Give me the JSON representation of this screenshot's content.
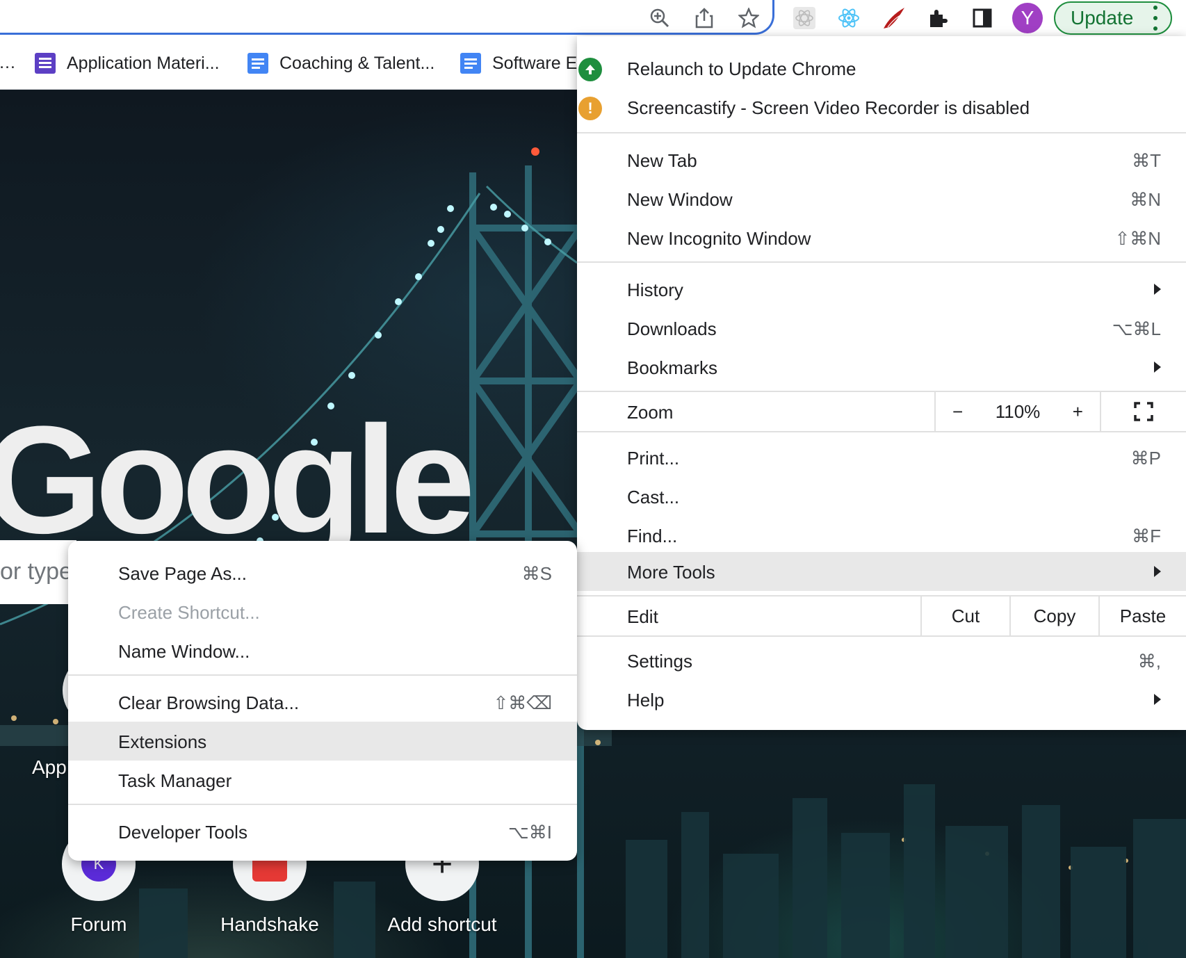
{
  "toolbar": {
    "avatar_letter": "Y",
    "update_label": "Update",
    "extension_icons": [
      "zoom-icon",
      "share-icon",
      "star-icon",
      "react-devtools-grey-icon",
      "react-devtools-icon",
      "red-wing-extension-icon",
      "puzzle-extensions-icon",
      "side-panel-icon"
    ]
  },
  "bookmarks": [
    {
      "label": "Application Materi...",
      "color": "#5c3fc4",
      "icon": "forms-icon"
    },
    {
      "label": "Coaching & Talent...",
      "color": "#4285f4",
      "icon": "docs-icon"
    },
    {
      "label": "Software E",
      "color": "#4285f4",
      "icon": "docs-icon"
    }
  ],
  "page": {
    "logo_text": "Google",
    "search_placeholder": "or type",
    "shortcuts": [
      {
        "label": "App"
      },
      {
        "label": "Forum",
        "icon_letter": "K"
      },
      {
        "label": "Handshake"
      },
      {
        "label": "Add shortcut",
        "icon": "+"
      }
    ]
  },
  "main_menu": {
    "notices": [
      {
        "text": "Relaunch to Update Chrome",
        "icon": "update-arrow-icon",
        "color": "#1e8e3e"
      },
      {
        "text": "Screencastify - Screen Video Recorder is disabled",
        "icon": "warning-icon",
        "color": "#e8a030",
        "glyph": "!"
      }
    ],
    "new_tab": {
      "label": "New Tab",
      "shortcut": "⌘T"
    },
    "new_window": {
      "label": "New Window",
      "shortcut": "⌘N"
    },
    "new_incognito": {
      "label": "New Incognito Window",
      "shortcut": "⇧⌘N"
    },
    "history": {
      "label": "History"
    },
    "downloads": {
      "label": "Downloads",
      "shortcut": "⌥⌘L"
    },
    "bookmarks": {
      "label": "Bookmarks"
    },
    "zoom": {
      "label": "Zoom",
      "minus": "−",
      "value": "110%",
      "plus": "+"
    },
    "print": {
      "label": "Print...",
      "shortcut": "⌘P"
    },
    "cast": {
      "label": "Cast..."
    },
    "find": {
      "label": "Find...",
      "shortcut": "⌘F"
    },
    "more_tools": {
      "label": "More Tools"
    },
    "edit": {
      "label": "Edit",
      "cut": "Cut",
      "copy": "Copy",
      "paste": "Paste"
    },
    "settings": {
      "label": "Settings",
      "shortcut": "⌘,"
    },
    "help": {
      "label": "Help"
    }
  },
  "more_tools_menu": {
    "save_page": {
      "label": "Save Page As...",
      "shortcut": "⌘S"
    },
    "create_shortcut": {
      "label": "Create Shortcut..."
    },
    "name_window": {
      "label": "Name Window..."
    },
    "clear_data": {
      "label": "Clear Browsing Data...",
      "shortcut": "⇧⌘⌫"
    },
    "extensions": {
      "label": "Extensions"
    },
    "task_manager": {
      "label": "Task Manager"
    },
    "developer_tools": {
      "label": "Developer Tools",
      "shortcut": "⌥⌘I"
    }
  }
}
